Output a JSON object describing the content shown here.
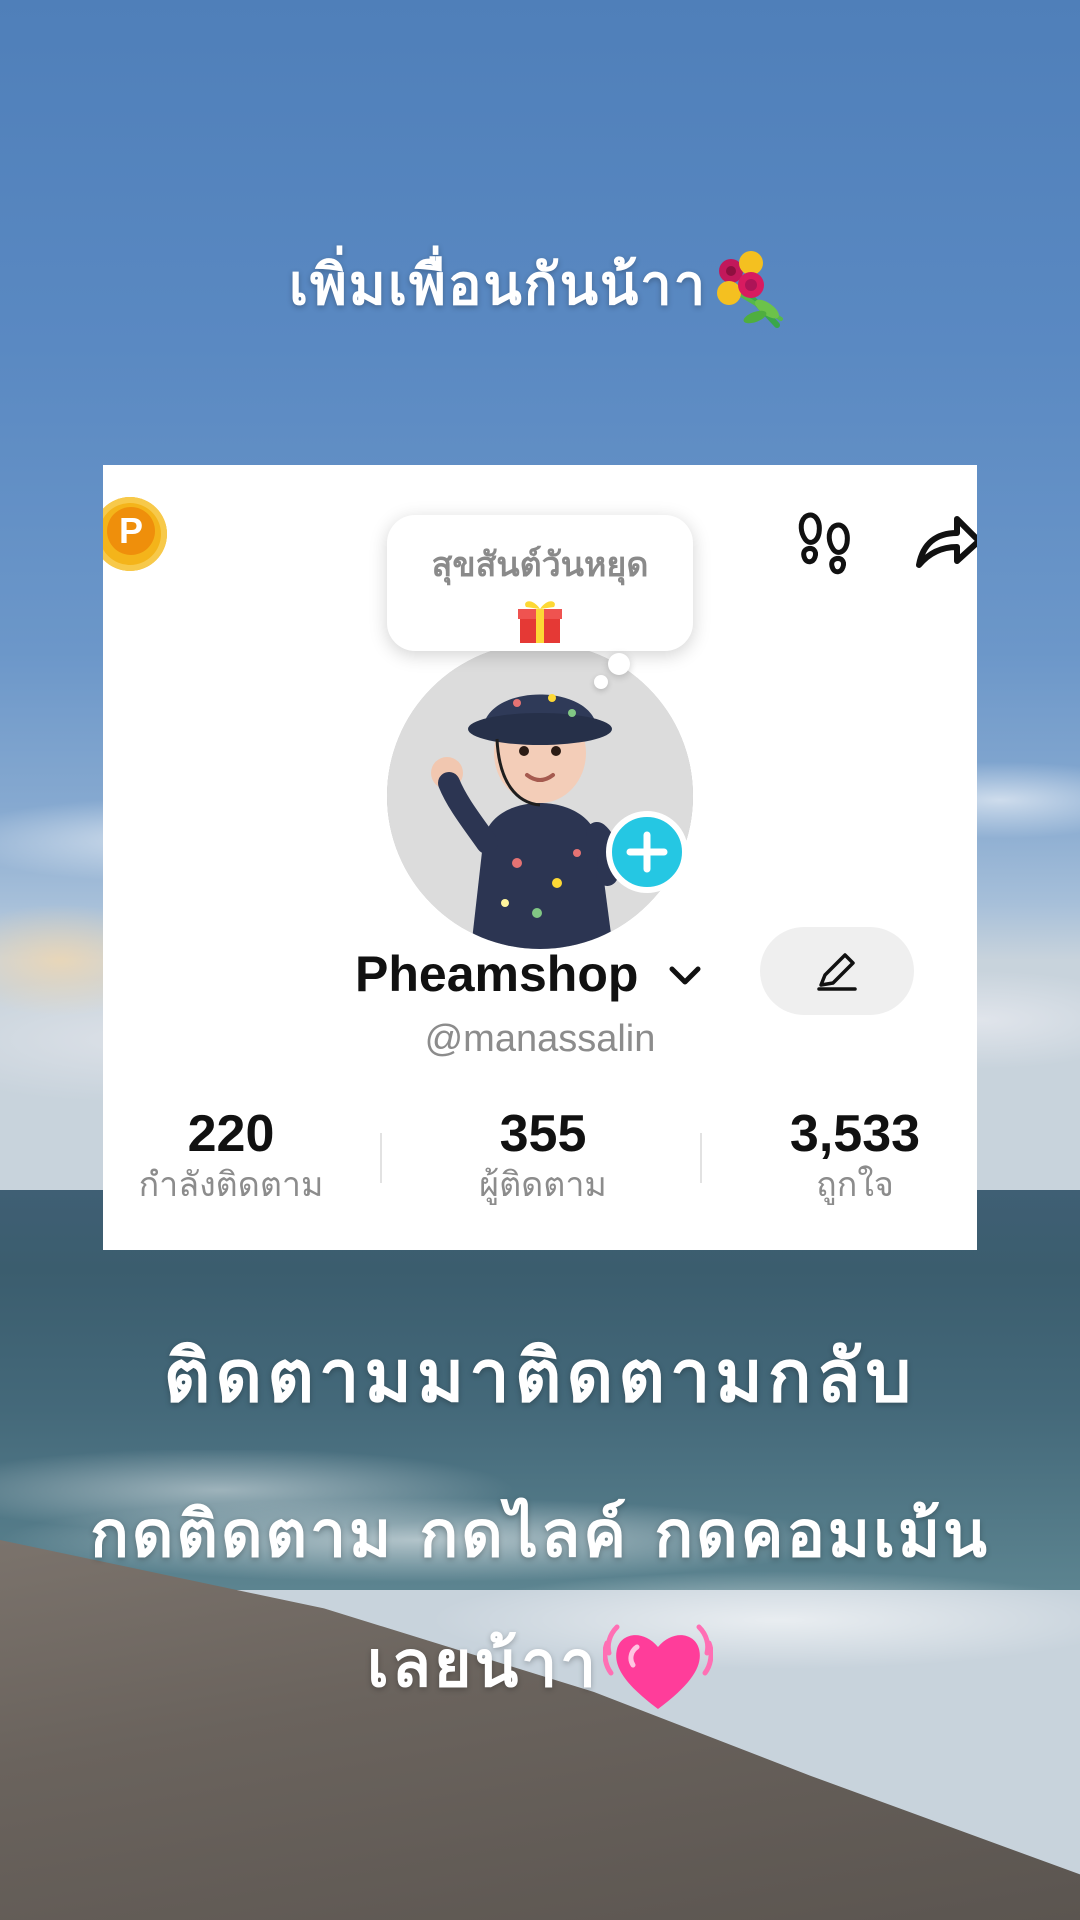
{
  "captions": {
    "top": "เพิ่มเพื่อนกันน้าา",
    "top_emoji": "bouquet-emoji",
    "middle": "ติดตามมาติดตามกลับ",
    "bottom_line1": "กดติดตาม กดไลค์ กดคอมเม้น",
    "bottom_line2": "เลยน้าา",
    "bottom_emoji": "beating-heart-emoji"
  },
  "profile": {
    "bubble_text": "สุขสันต์วันหยุด",
    "bubble_emoji": "gift-emoji",
    "coin_letter": "P",
    "username": "Pheamshop",
    "handle": "@manassalin",
    "stats": [
      {
        "value": "220",
        "label": "กำลังติดตาม"
      },
      {
        "value": "355",
        "label": "ผู้ติดตาม"
      },
      {
        "value": "3,533",
        "label": "ถูกใจ"
      }
    ]
  },
  "colors": {
    "accent_add": "#25c7e3",
    "coin": "#f4b41a",
    "heart": "#ff3d9a"
  }
}
